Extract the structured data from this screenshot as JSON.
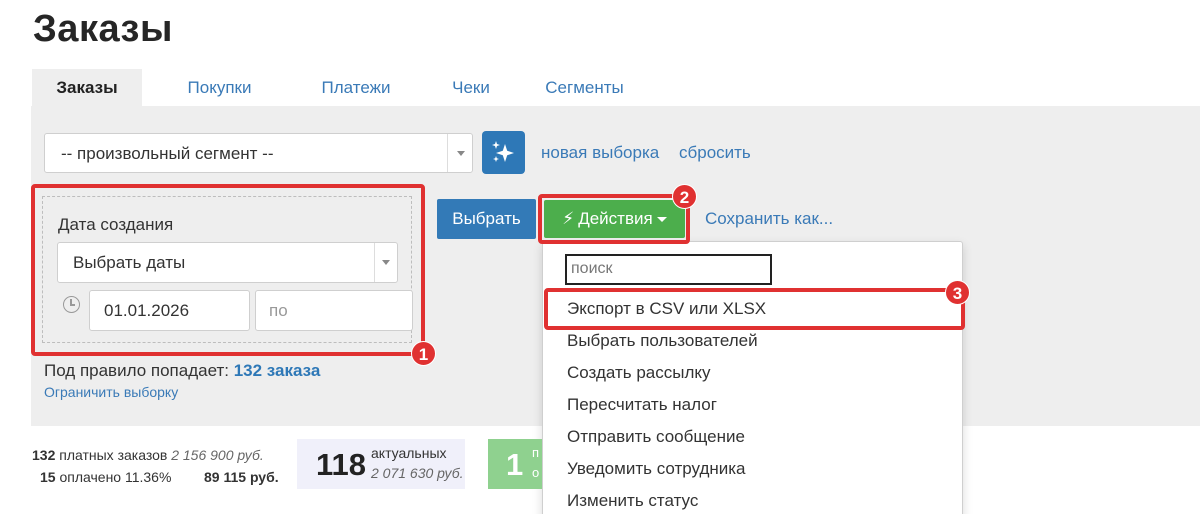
{
  "page": {
    "title": "Заказы"
  },
  "tabs": [
    {
      "label": "Заказы",
      "active": true
    },
    {
      "label": "Покупки"
    },
    {
      "label": "Платежи"
    },
    {
      "label": "Чеки"
    },
    {
      "label": "Сегменты"
    }
  ],
  "filter": {
    "segment_value": "-- произвольный сегмент --",
    "new_selection": "новая выборка",
    "reset": "сбросить",
    "date_label": "Дата создания",
    "date_select_value": "Выбрать даты",
    "date_from": "01.01.2026",
    "date_to_placeholder": "по",
    "rule_prefix": "Под правило попадает:",
    "rule_count": "132 заказа",
    "limit_link": "Ограничить выборку"
  },
  "toolbar": {
    "select_label": "Выбрать",
    "actions_label": "Действия",
    "save_as": "Сохранить как..."
  },
  "dropdown": {
    "search_placeholder": "поиск",
    "items": [
      "Экспорт в CSV или XLSX",
      "Выбрать пользователей",
      "Создать рассылку",
      "Пересчитать налог",
      "Отправить сообщение",
      "Уведомить сотрудника",
      "Изменить статус"
    ]
  },
  "badges": [
    "1",
    "2",
    "3"
  ],
  "stats": {
    "paid_count": "132",
    "paid_label": "платных заказов",
    "paid_sum": "2 156 900 руб.",
    "paid_done_count": "15",
    "paid_done_label": "оплачено 11.36%",
    "paid_done_sum": "89 115 руб.",
    "actual_count": "118",
    "actual_label": "актуальных",
    "actual_sum": "2 071 630 руб.",
    "green_count": "1",
    "green_cut1": "п",
    "green_cut2": "о"
  },
  "colors": {
    "link": "#3a7ab7",
    "primary": "#337ab7",
    "success": "#4cae4c",
    "highlight": "#e03131"
  }
}
